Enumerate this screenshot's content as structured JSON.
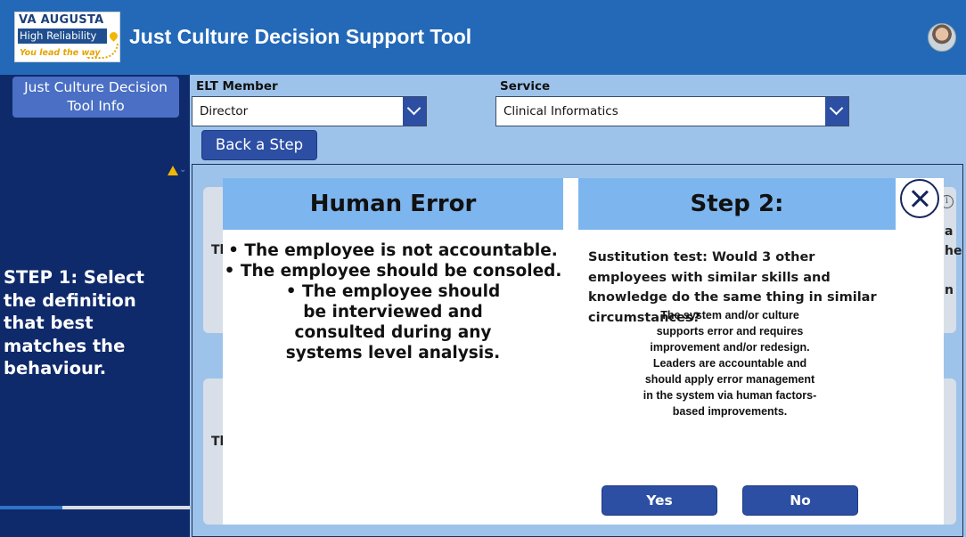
{
  "header": {
    "logo": {
      "line1": "VA AUGUSTA",
      "line2": "High Reliability",
      "line3": "You lead the way"
    },
    "title": "Just Culture Decision Support Tool"
  },
  "sidebar": {
    "info_button": "Just Culture Decision Tool Info",
    "step1_text": "STEP 1: Select the definition that best matches the behaviour."
  },
  "controls": {
    "elt_label": "ELT Member",
    "elt_value": "Director",
    "service_label": "Service",
    "service_value": "Clinical Informatics",
    "back_button": "Back a Step"
  },
  "background_cards": {
    "card1_text": "Th",
    "card2_text": "Th",
    "card1_right_fragments": [
      "a",
      "he",
      "n"
    ]
  },
  "modal": {
    "left_header": "Human Error",
    "left_bullets": [
      "• The employee is not accountable.",
      "• The employee should be consoled.",
      "• The employee should be interviewed and consulted during any systems level analysis."
    ],
    "right_header": "Step 2:",
    "question": "Sustitution test: Would 3 other employees with similar skills and knowledge do the same thing in similar circumstances?",
    "answer_text": "The system and/or culture supports error and requires improvement and/or redesign. Leaders are accountable and should apply error management in the system via human factors-based improvements.",
    "yes_button": "Yes",
    "no_button": "No"
  },
  "colors": {
    "header_bg": "#2469b8",
    "sidebar_bg": "#0f2a6b",
    "page_bg": "#9ec3ea",
    "button_bg": "#2c4fa3",
    "modal_header_bg": "#7db5ee"
  }
}
